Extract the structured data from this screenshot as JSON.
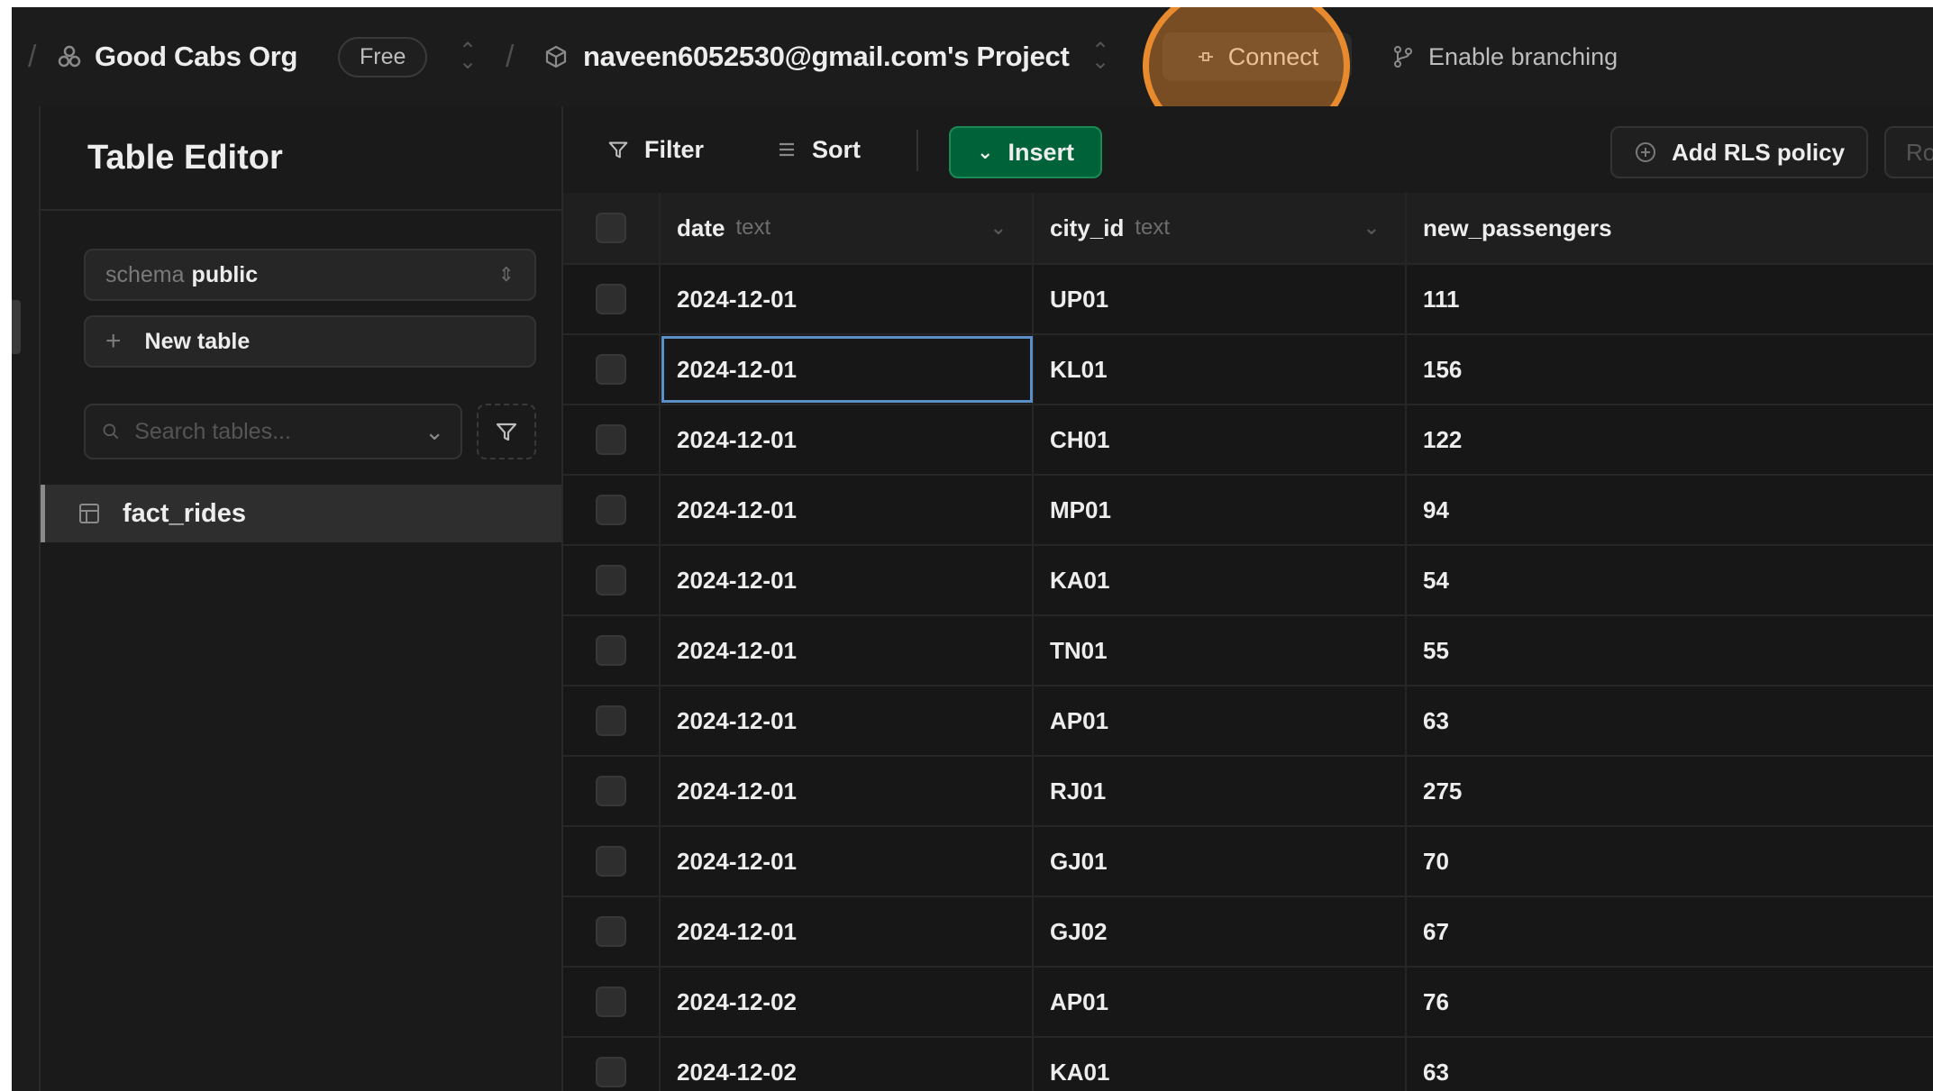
{
  "topbar": {
    "org_name": "Good Cabs Org",
    "plan_badge": "Free",
    "project_name": "naveen6052530@gmail.com's Project",
    "connect_label": "Connect",
    "branching_label": "Enable branching"
  },
  "sidebar": {
    "title": "Table Editor",
    "schema_label": "schema",
    "schema_value": "public",
    "new_table_label": "New table",
    "search_placeholder": "Search tables...",
    "tables": [
      {
        "name": "fact_rides"
      }
    ]
  },
  "toolbar": {
    "filter_label": "Filter",
    "sort_label": "Sort",
    "insert_label": "Insert",
    "rls_label": "Add RLS policy",
    "role_label": "Role"
  },
  "grid": {
    "columns": [
      {
        "name": "date",
        "type": "text"
      },
      {
        "name": "city_id",
        "type": "text"
      },
      {
        "name": "new_passengers",
        "type": ""
      }
    ],
    "rows": [
      [
        "2024-12-01",
        "UP01",
        "111"
      ],
      [
        "2024-12-01",
        "KL01",
        "156"
      ],
      [
        "2024-12-01",
        "CH01",
        "122"
      ],
      [
        "2024-12-01",
        "MP01",
        "94"
      ],
      [
        "2024-12-01",
        "KA01",
        "54"
      ],
      [
        "2024-12-01",
        "TN01",
        "55"
      ],
      [
        "2024-12-01",
        "AP01",
        "63"
      ],
      [
        "2024-12-01",
        "RJ01",
        "275"
      ],
      [
        "2024-12-01",
        "GJ01",
        "70"
      ],
      [
        "2024-12-01",
        "GJ02",
        "67"
      ],
      [
        "2024-12-02",
        "AP01",
        "76"
      ],
      [
        "2024-12-02",
        "KA01",
        "63"
      ]
    ]
  },
  "colors": {
    "background": "#171717",
    "insert_green": "#006239",
    "highlight_orange": "#e88a2e",
    "selection_blue": "#5a8fc8"
  }
}
